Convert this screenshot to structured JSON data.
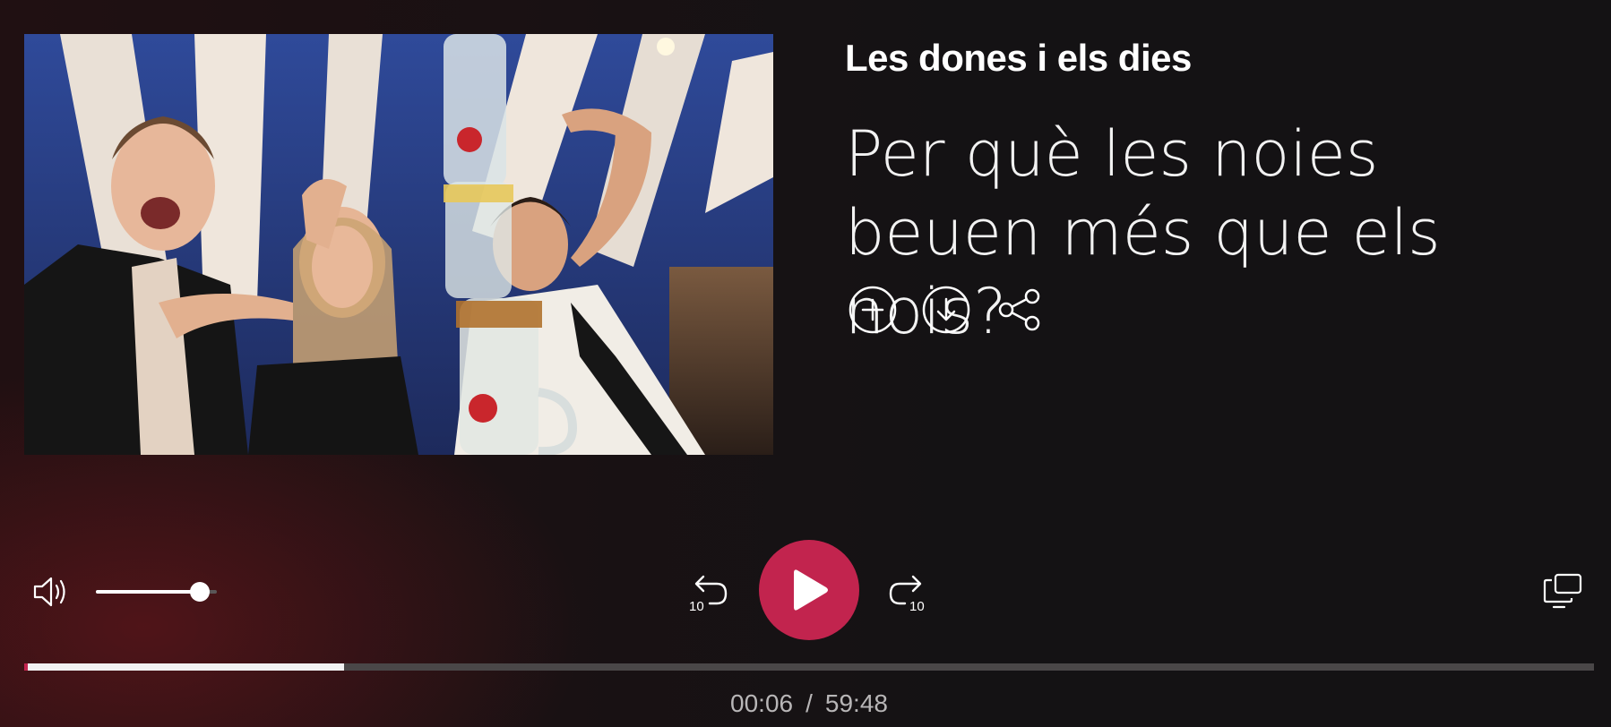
{
  "program": {
    "name": "Les dones i els dies"
  },
  "episode": {
    "title": "Per què les noies beuen més que els nois?"
  },
  "actions": {
    "add_icon": "plus-circle-icon",
    "download_icon": "download-circle-icon",
    "share_icon": "share-icon"
  },
  "player": {
    "volume_level": 0.86,
    "skip_back_label": "10",
    "skip_forward_label": "10",
    "progress_fraction": 0.204,
    "current_time": "00:06",
    "time_separator": "/",
    "duration": "59:48"
  },
  "colors": {
    "accent": "#c2244e",
    "background": "#141214",
    "text": "#ffffff",
    "time_text": "#b8b6b7"
  }
}
